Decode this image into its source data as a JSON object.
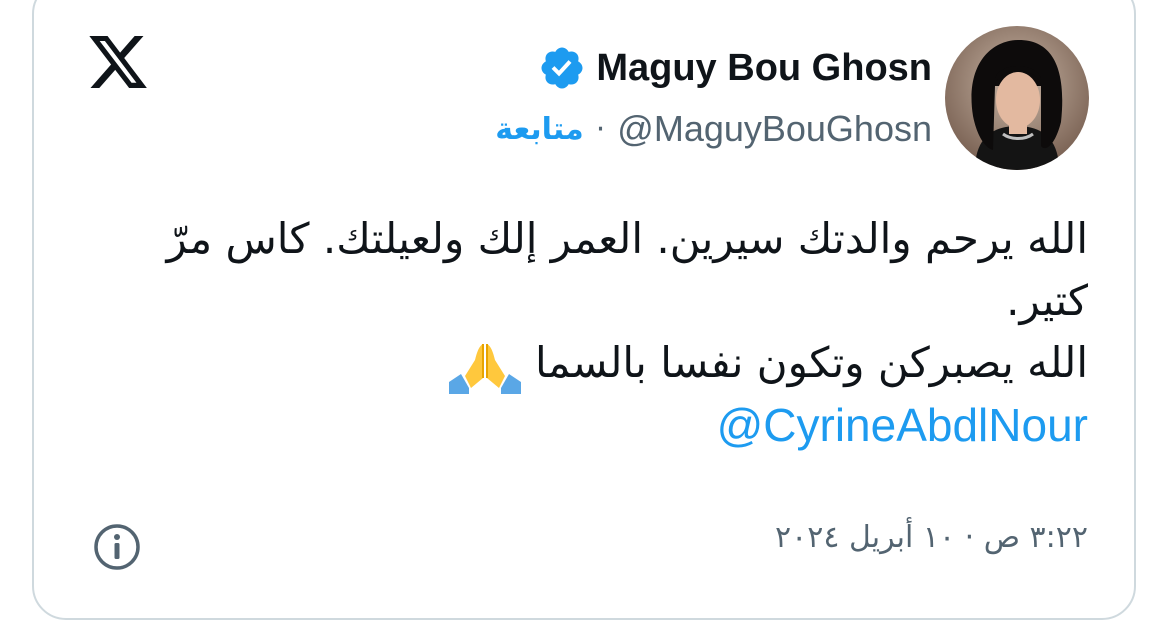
{
  "tweet": {
    "display_name": "Maguy Bou Ghosn",
    "handle": "@MaguyBouGhosn",
    "separator": "·",
    "follow_label": "متابعة",
    "body_line1": "الله يرحم والدتك سيرين. العمر إلك ولعيلتك. كاس مرّ كتير.",
    "body_line2": "الله يصبركن وتكون نفسا بالسما",
    "mention": "@CyrineAbdlNour",
    "timestamp": "٣:٢٢ ص · ١٠ أبريل ٢٠٢٤"
  },
  "icons": {
    "logo": "x-logo-icon",
    "verified": "verified-badge-icon",
    "emoji": "folded-hands-emoji",
    "info": "info-icon"
  },
  "colors": {
    "accent": "#1d9bf0",
    "text": "#0f1419",
    "secondary": "#536471",
    "border": "#cfd9de"
  }
}
